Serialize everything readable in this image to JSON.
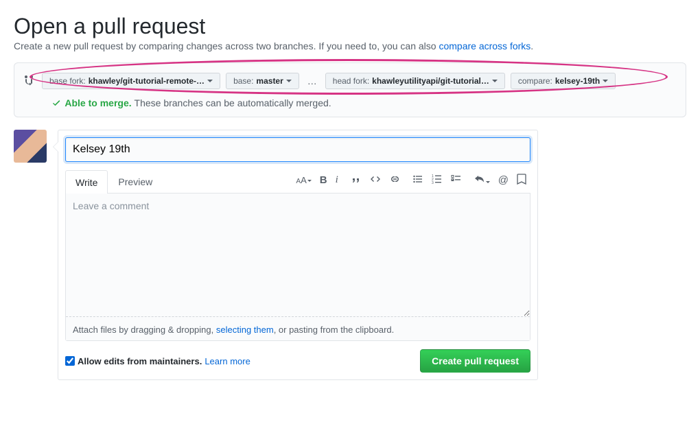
{
  "header": {
    "title": "Open a pull request",
    "subtitle_before": "Create a new pull request by comparing changes across two branches. If you need to, you can also ",
    "subtitle_link": "compare across forks",
    "subtitle_after": "."
  },
  "compare": {
    "base_fork_label": "base fork:",
    "base_fork_value": "khawley/git-tutorial-remote-…",
    "base_branch_label": "base:",
    "base_branch_value": "master",
    "ellipsis": "…",
    "head_fork_label": "head fork:",
    "head_fork_value": "khawleyutilityapi/git-tutorial…",
    "compare_label": "compare:",
    "compare_value": "kelsey-19th",
    "mergeable_status": "Able to merge.",
    "mergeable_detail": "These branches can be automatically merged."
  },
  "form": {
    "title_value": "Kelsey 19th",
    "write_tab": "Write",
    "preview_tab": "Preview",
    "comment_placeholder": "Leave a comment",
    "attach_before": "Attach files by dragging & dropping, ",
    "attach_link": "selecting them",
    "attach_after": ", or pasting from the clipboard.",
    "allow_edits_label": "Allow edits from maintainers.",
    "learn_more": "Learn more",
    "create_button": "Create pull request"
  },
  "toolbar_icons": {
    "text_size": "AA",
    "bold": "B",
    "italic": "i",
    "quote": "❝❝",
    "code": "<>",
    "link": "🔗",
    "ul": "≡",
    "ol": "≡",
    "task": "≡",
    "reply": "↶",
    "mention": "@",
    "bookmark": "🔖"
  },
  "colors": {
    "accent": "#0366d6",
    "success": "#28a745",
    "highlight": "#d63384"
  }
}
